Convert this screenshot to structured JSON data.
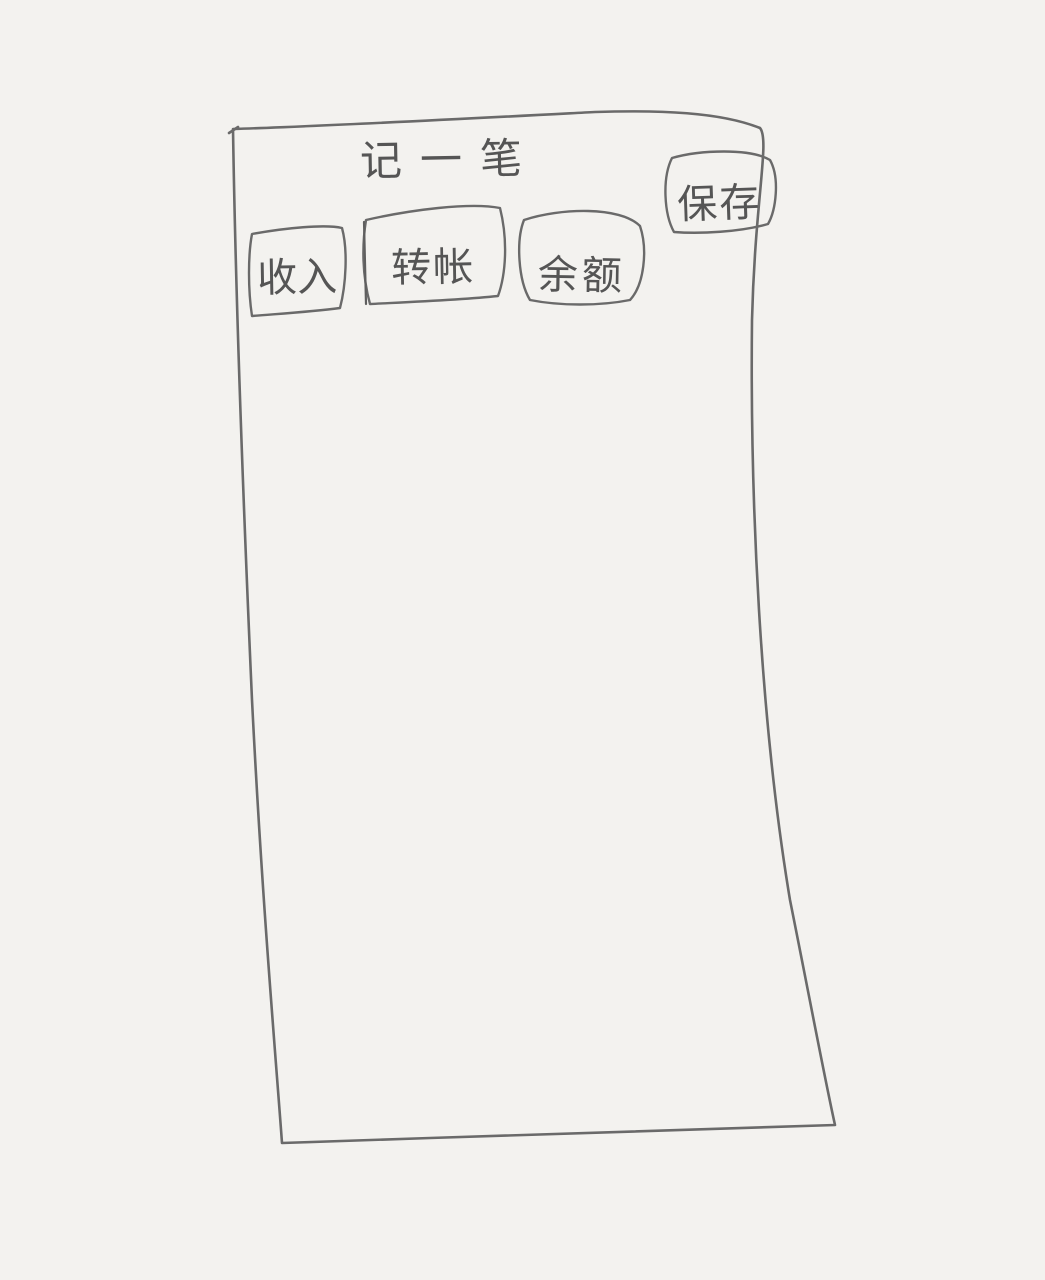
{
  "header": {
    "title": "记一笔",
    "save_label": "保存"
  },
  "tabs": [
    {
      "label": "收入"
    },
    {
      "label": "转帐"
    },
    {
      "label": "余额"
    }
  ]
}
